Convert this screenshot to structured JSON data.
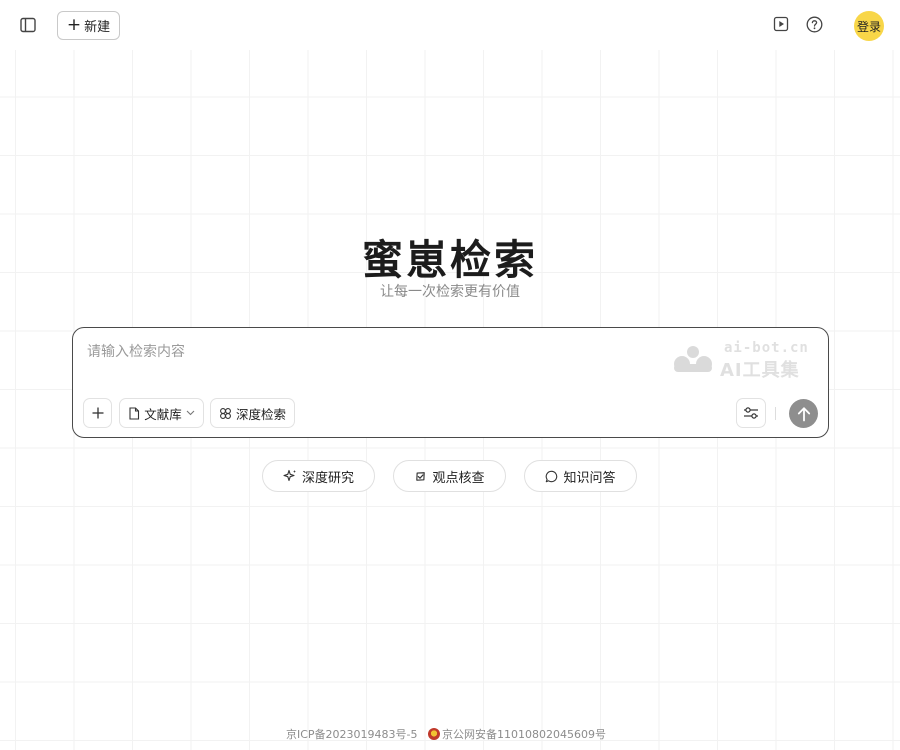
{
  "header": {
    "new_label": "新建",
    "login_label": "登录",
    "accent_color": "#f8d648"
  },
  "hero": {
    "title": "蜜崽检索",
    "subtitle": "让每一次检索更有价值"
  },
  "search": {
    "placeholder": "请输入检索内容",
    "value": "",
    "library_label": "文献库",
    "deep_search_label": "深度检索"
  },
  "watermark": {
    "url": "ai-bot.cn",
    "name": "AI工具集"
  },
  "suggestions": [
    {
      "label": "深度研究",
      "icon": "sparkle-icon"
    },
    {
      "label": "观点核查",
      "icon": "check-badge-icon"
    },
    {
      "label": "知识问答",
      "icon": "chat-bubble-icon"
    }
  ],
  "footer": {
    "icp": "京ICP备2023019483号-5",
    "police": "京公网安备11010802045609号"
  }
}
